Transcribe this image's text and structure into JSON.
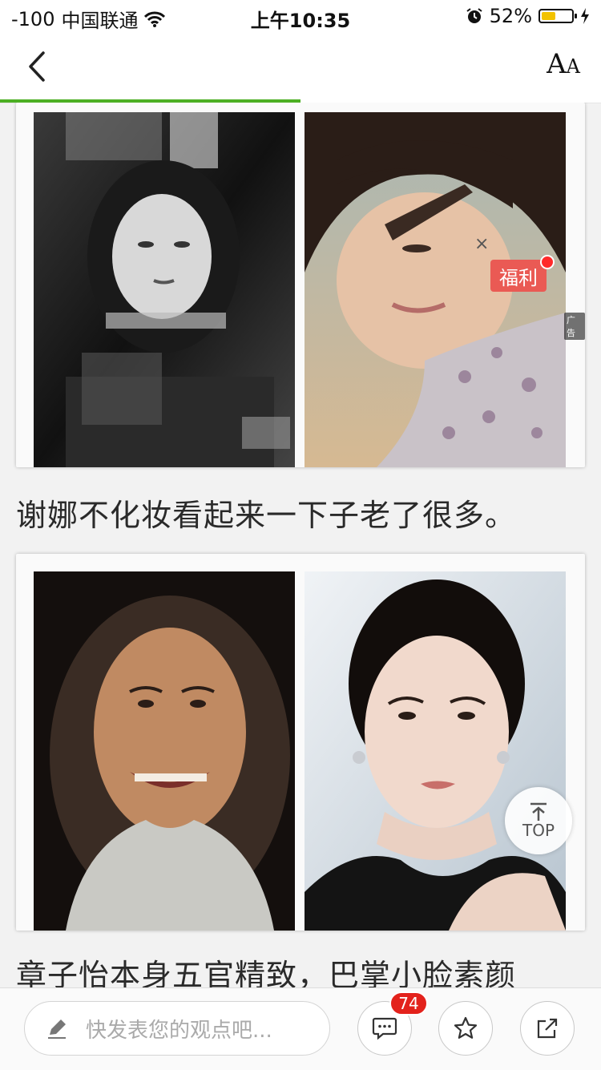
{
  "status_bar": {
    "signal": "-100",
    "carrier": "中国联通",
    "time": "上午10:35",
    "battery_percent": "52%",
    "battery_level": 0.52
  },
  "nav": {
    "back_icon": "chevron-left-icon",
    "font_size_label_big": "A",
    "font_size_label_small": "A",
    "reading_progress": 0.5
  },
  "article": {
    "caption_1": "谢娜不化妆看起来一下子老了很多。",
    "caption_2": "章子怡本身五官精致，巴掌小脸素颜"
  },
  "ad": {
    "close": "×",
    "badge": "福利",
    "label": "广告"
  },
  "top_button": {
    "label": "TOP"
  },
  "bottom_bar": {
    "comment_placeholder": "快发表您的观点吧...",
    "comment_count": "74"
  },
  "colors": {
    "progress_green": "#4caf23",
    "badge_red": "#e3221c",
    "ad_red": "#ea5a54"
  }
}
